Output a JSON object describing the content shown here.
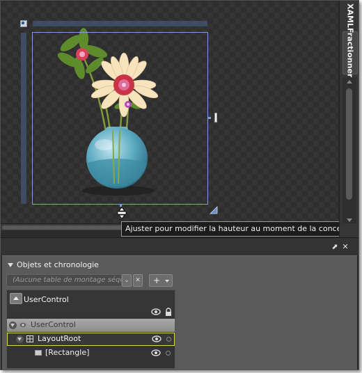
{
  "design_surface": {
    "tooltip": "Ajuster pour modifier la hauteur au moment de la conception",
    "image_description_icon": "flower-vase-image"
  },
  "view_tabs": [
    {
      "label": "XAML"
    },
    {
      "label": "Fractionner"
    }
  ],
  "objects_panel": {
    "title": "Objets et chronologie",
    "storyboard_placeholder": "(Aucune table de montage séquentiel",
    "add_button_label": "+",
    "scope_title": "UserControl",
    "tree": [
      {
        "label": "UserControl",
        "level": 0
      },
      {
        "label": "LayoutRoot",
        "level": 1,
        "selected": true
      },
      {
        "label": "[Rectangle]",
        "level": 2
      }
    ]
  },
  "colors": {
    "selection_blue": "#7c9fd8",
    "selected_row_border": "#d9d94a",
    "panel_bg": "#5a5a5a",
    "surface_bg": "#2e2e2e"
  }
}
